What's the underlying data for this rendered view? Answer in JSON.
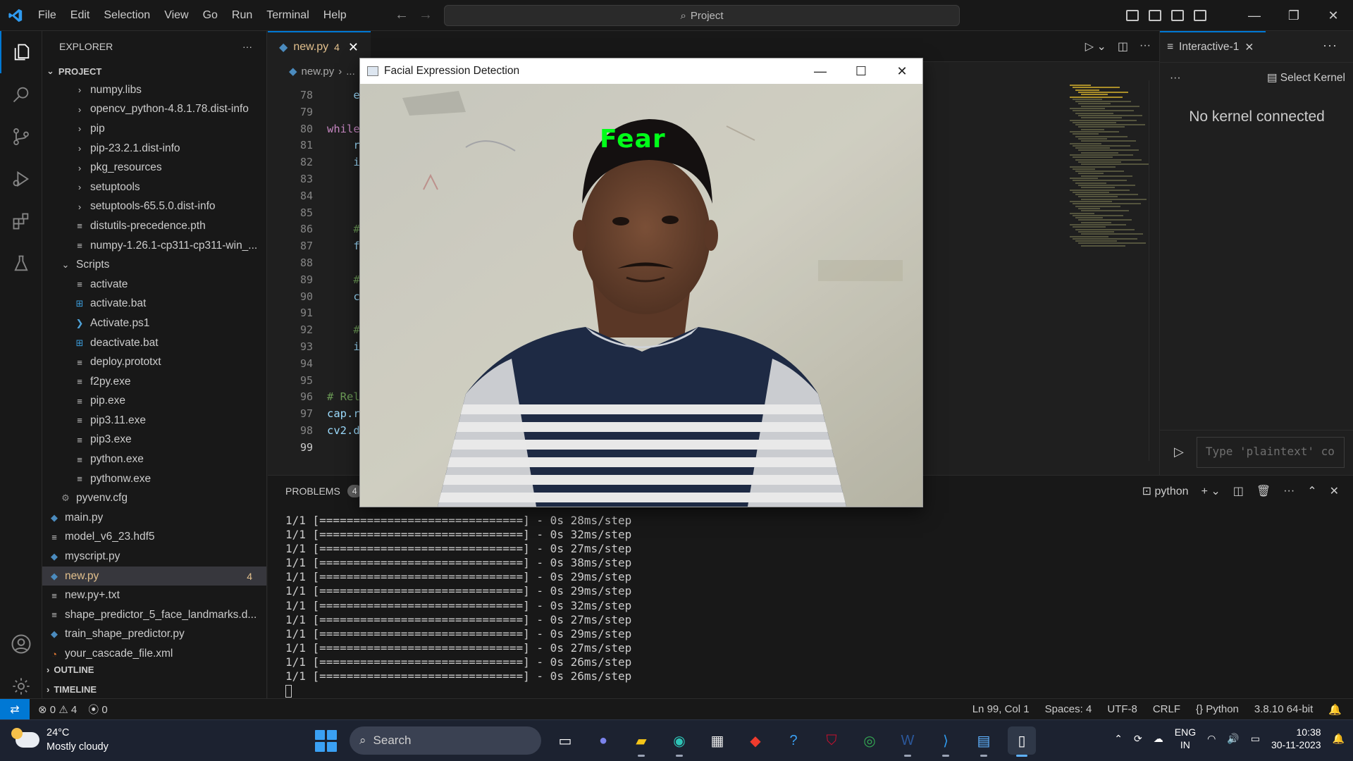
{
  "titlebar": {
    "menu": [
      "File",
      "Edit",
      "Selection",
      "View",
      "Go",
      "Run",
      "Terminal",
      "Help"
    ],
    "command_center": "Project"
  },
  "sidebar": {
    "title": "EXPLORER",
    "project_label": "PROJECT",
    "outline_label": "OUTLINE",
    "timeline_label": "TIMELINE",
    "items": [
      {
        "label": "numpy.libs",
        "icon": "chevron-right-icon"
      },
      {
        "label": "opencv_python-4.8.1.78.dist-info",
        "icon": "chevron-right-icon"
      },
      {
        "label": "pip",
        "icon": "chevron-right-icon"
      },
      {
        "label": "pip-23.2.1.dist-info",
        "icon": "chevron-right-icon"
      },
      {
        "label": "pkg_resources",
        "icon": "chevron-right-icon"
      },
      {
        "label": "setuptools",
        "icon": "chevron-right-icon"
      },
      {
        "label": "setuptools-65.5.0.dist-info",
        "icon": "chevron-right-icon"
      },
      {
        "label": "distutils-precedence.pth",
        "icon": "file-lines-icon"
      },
      {
        "label": "numpy-1.26.1-cp311-cp311-win_...",
        "icon": "file-lines-icon"
      },
      {
        "label": "Scripts",
        "icon": "chevron-down-icon"
      },
      {
        "label": "activate",
        "icon": "file-lines-icon"
      },
      {
        "label": "activate.bat",
        "icon": "windows-icon"
      },
      {
        "label": "Activate.ps1",
        "icon": "powershell-icon"
      },
      {
        "label": "deactivate.bat",
        "icon": "windows-icon"
      },
      {
        "label": "deploy.prototxt",
        "icon": "file-lines-icon"
      },
      {
        "label": "f2py.exe",
        "icon": "file-lines-icon"
      },
      {
        "label": "pip.exe",
        "icon": "file-lines-icon"
      },
      {
        "label": "pip3.11.exe",
        "icon": "file-lines-icon"
      },
      {
        "label": "pip3.exe",
        "icon": "file-lines-icon"
      },
      {
        "label": "python.exe",
        "icon": "file-lines-icon"
      },
      {
        "label": "pythonw.exe",
        "icon": "file-lines-icon"
      },
      {
        "label": "pyvenv.cfg",
        "icon": "gear-icon"
      },
      {
        "label": "main.py",
        "icon": "python-icon"
      },
      {
        "label": "model_v6_23.hdf5",
        "icon": "file-lines-icon"
      },
      {
        "label": "myscript.py",
        "icon": "python-icon"
      },
      {
        "label": "new.py",
        "icon": "python-icon",
        "badge": "4"
      },
      {
        "label": "new.py+.txt",
        "icon": "file-lines-icon"
      },
      {
        "label": "shape_predictor_5_face_landmarks.d...",
        "icon": "file-lines-icon"
      },
      {
        "label": "train_shape_predictor.py",
        "icon": "python-icon"
      },
      {
        "label": "your_cascade_file.xml",
        "icon": "rss-icon"
      }
    ]
  },
  "editor": {
    "tab_label": "new.py",
    "tab_problems": "4",
    "breadcrumb": [
      "new.py",
      "..."
    ],
    "line_numbers": [
      "78",
      "79",
      "80",
      "81",
      "82",
      "83",
      "84",
      "85",
      "86",
      "87",
      "88",
      "89",
      "90",
      "91",
      "92",
      "93",
      "94",
      "95",
      "96",
      "97",
      "98",
      "99"
    ],
    "current_line": "99",
    "code_lines": [
      "    e",
      "",
      "while",
      "    r",
      "    i",
      "",
      "",
      "",
      "    #",
      "    f",
      "",
      "    #",
      "    c",
      "",
      "    #",
      "    i",
      "",
      "",
      "# Rel",
      "cap.r",
      "cv2.d",
      ""
    ]
  },
  "interactive": {
    "tab_label": "Interactive-1",
    "select_kernel": "Select Kernel",
    "no_kernel": "No kernel connected",
    "input_placeholder": "Type 'plaintext' co"
  },
  "panel": {
    "problems_label": "PROBLEMS",
    "problems_count": "4",
    "terminal_name": "python",
    "lines": [
      "1/1 [==============================] - 0s 28ms/step",
      "1/1 [==============================] - 0s 32ms/step",
      "1/1 [==============================] - 0s 27ms/step",
      "1/1 [==============================] - 0s 38ms/step",
      "1/1 [==============================] - 0s 29ms/step",
      "1/1 [==============================] - 0s 29ms/step",
      "1/1 [==============================] - 0s 32ms/step",
      "1/1 [==============================] - 0s 27ms/step",
      "1/1 [==============================] - 0s 29ms/step",
      "1/1 [==============================] - 0s 27ms/step",
      "1/1 [==============================] - 0s 26ms/step",
      "1/1 [==============================] - 0s 26ms/step"
    ]
  },
  "cv_window": {
    "title": "Facial Expression Detection",
    "emotion_label": "Fear",
    "emotion_color": "#00ff19"
  },
  "statusbar": {
    "errors": "0",
    "warnings": "4",
    "ports": "0",
    "position": "Ln 99, Col 1",
    "spaces": "Spaces: 4",
    "encoding": "UTF-8",
    "eol": "CRLF",
    "language": "Python",
    "interpreter": "3.8.10 64-bit"
  },
  "taskbar": {
    "temperature": "24°C",
    "weather": "Mostly cloudy",
    "search": "Search",
    "lang_top": "ENG",
    "lang_bottom": "IN",
    "time": "10:38",
    "date": "30-11-2023"
  },
  "colors": {
    "accent": "#0078d4",
    "modified": "#e2c08d"
  }
}
